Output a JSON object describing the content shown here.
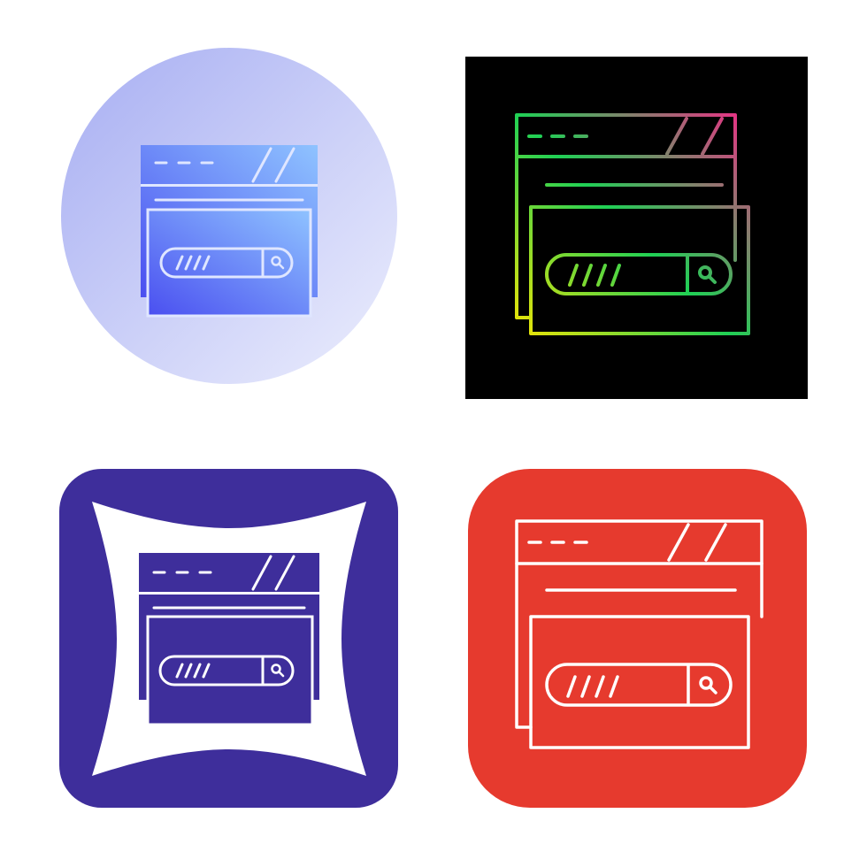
{
  "icon_set": {
    "subject": "browser-search-window-icon",
    "variants": [
      {
        "style": "gradient-glyph-on-circle",
        "background": "#b9c0f5",
        "foreground": [
          "#4a5ef0",
          "#8ab4ff"
        ]
      },
      {
        "style": "gradient-outline-on-black",
        "background": "#000000",
        "foreground": [
          "#ffe600",
          "#00d05a",
          "#ff1f8a"
        ]
      },
      {
        "style": "glyph-on-rounded-square-with-pillow",
        "background": "#3e2e9b",
        "foreground": [
          "#3e2e9b",
          "#ffffff"
        ]
      },
      {
        "style": "white-outline-on-rounded-square",
        "background": "#e63a2e",
        "foreground": [
          "#ffffff"
        ]
      }
    ]
  }
}
